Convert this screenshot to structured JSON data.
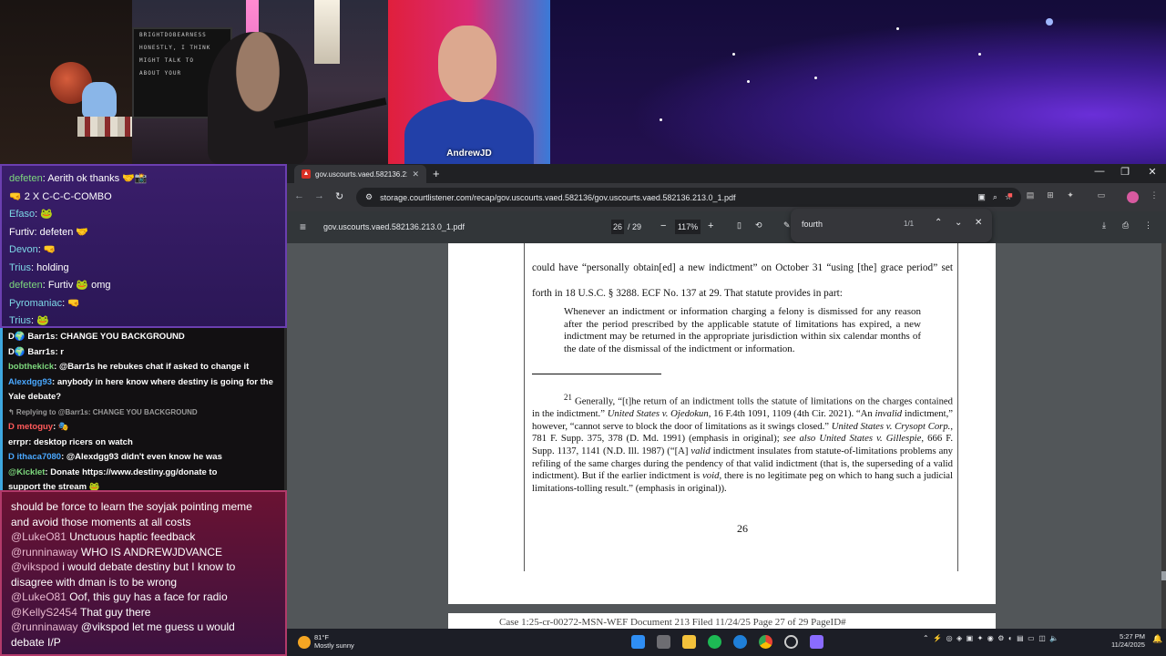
{
  "stream": {
    "cam1_lightbox_text": [
      "BRIGHTDOBEARNESS",
      "HONESTLY, I THINK",
      "MIGHT TALK TO",
      "ABOUT YOUR"
    ],
    "cam2_name": "AndrewJD"
  },
  "chat_a": [
    {
      "name": "defeten",
      "name_color": "#7dd87d",
      "text": "Aerith ok thanks 🤝📸"
    },
    {
      "name": "",
      "name_color": "#ffffff",
      "text": "🤜 2 X C-C-C-COMBO"
    },
    {
      "name": "Efaso",
      "name_color": "#7dd8e6",
      "text": "🐸"
    },
    {
      "name": "Furtiv",
      "name_color": "#ffffff",
      "text": "defeten 🤝"
    },
    {
      "name": "Devon",
      "name_color": "#7dd8e6",
      "text": "🤜"
    },
    {
      "name": "Trius",
      "name_color": "#7dd8e6",
      "text": "holding"
    },
    {
      "name": "defeten",
      "name_color": "#7dd87d",
      "text": "Furtiv 🐸 omg"
    },
    {
      "name": "Pyromaniac",
      "name_color": "#7dd8e6",
      "text": "🤜"
    },
    {
      "name": "Trius",
      "name_color": "#7dd8e6",
      "text": "🐸"
    }
  ],
  "chat_b": [
    {
      "name": "D🌍 Barr1s",
      "name_color": "#ffffff",
      "text": "CHANGE YOU BACKGROUND"
    },
    {
      "name": "D🌍 Barr1s",
      "name_color": "#ffffff",
      "text": "r"
    },
    {
      "name": "bobthekick",
      "name_color": "#7dd87d",
      "text": "@Barr1s he rebukes chat if asked to change it"
    },
    {
      "name": "Alexdgg93",
      "name_color": "#4aa8ff",
      "text": "anybody in here know where destiny is going for the"
    },
    {
      "name": "",
      "name_color": "#ffffff",
      "text": "Yale debate?"
    },
    {
      "name": "reply",
      "name_color": "#9a9a9a",
      "text": "↰ Replying to @Barr1s: CHANGE YOU BACKGROUND"
    },
    {
      "name": "D metoguy",
      "name_color": "#ff5a5a",
      "text": "🎭"
    },
    {
      "name": "errpr",
      "name_color": "#ffffff",
      "text": "desktop ricers on watch"
    },
    {
      "name": "D ithaca7080",
      "name_color": "#4aa8ff",
      "text": "@Alexdgg93 didn't even know he was"
    },
    {
      "name": "@Kicklet",
      "name_color": "#7dd87d",
      "text": "Donate https://www.destiny.gg/donate to"
    },
    {
      "name": "",
      "name_color": "#ffffff",
      "text": "support the stream 🐸"
    }
  ],
  "chat_c": [
    {
      "at": "",
      "text": "should be force to learn the soyjak pointing meme"
    },
    {
      "at": "",
      "text": "and avoid those moments at all costs"
    },
    {
      "at": "@LukeO81",
      "text": " Unctuous haptic feedback"
    },
    {
      "at": "@runninaway",
      "text": " WHO IS ANDREWJDVANCE"
    },
    {
      "at": "@vikspod",
      "text": " i would debate destiny but I know to"
    },
    {
      "at": "",
      "text": "disagree with dman is to be wrong"
    },
    {
      "at": "@LukeO81",
      "text": " Oof, this guy has a face for radio"
    },
    {
      "at": "@KellyS2454",
      "text": " That guy there"
    },
    {
      "at": "@runninaway",
      "text": " @vikspod let me guess u would"
    },
    {
      "at": "",
      "text": "debate I/P"
    }
  ],
  "browser": {
    "tab_title": "gov.uscourts.vaed.582136.213.0_1.pdf",
    "url": "storage.courtlistener.com/recap/gov.uscourts.vaed.582136/gov.uscourts.vaed.582136.213.0_1.pdf",
    "pdf_title": "gov.uscourts.vaed.582136.213.0_1.pdf",
    "page_current": "26",
    "page_total": "/ 29",
    "zoom": "117%",
    "find_query": "fourth",
    "find_count": "1/1"
  },
  "document": {
    "p1": "could have “personally obtain[ed] a new indictment” on October 31 “using [the] grace period” set forth in 18 U.S.C. § 3288.  ECF No. 137 at 29.  That statute provides in part:",
    "quote": "Whenever an indictment or information charging a felony is dismissed for any reason after the period prescribed by the applicable statute of limitations has expired, a new indictment may be returned in the appropriate jurisdiction within six calendar months of the date of the dismissal of the indictment or information.",
    "fn_num": "21",
    "fn_a": " Generally, “[t]he return of an indictment tolls the statute of limitations on the charges contained in the indictment.”  ",
    "fn_b": "United States v. Ojedokun",
    "fn_c": ", 16 F.4th 1091, 1109 (4th Cir. 2021).  “An ",
    "fn_d": "invalid",
    "fn_e": " indictment,” however, “cannot serve to block the door of limitations as it swings closed.” ",
    "fn_f": "United States v. Crysopt Corp.",
    "fn_g": ", 781 F. Supp. 375, 378 (D. Md. 1991) (emphasis in original); ",
    "fn_h": "see also United States v. Gillespie",
    "fn_i": ", 666 F. Supp. 1137, 1141 (N.D. Ill. 1987) (“[A] ",
    "fn_j": "valid",
    "fn_k": " indictment insulates from statute-of-limitations problems any refiling of the same charges during the pendency of that valid indictment (that is, the superseding of a valid indictment).  But if the earlier indictment is ",
    "fn_l": "void,",
    "fn_m": " there is no legitimate peg on which to hang such a judicial limitations-tolling result.” (emphasis in original)).",
    "page_number": "26",
    "next_header": "Case 1:25-cr-00272-MSN-WEF     Document 213     Filed 11/24/25     Page 27 of 29 PageID#"
  },
  "taskbar": {
    "temp": "81°F",
    "weather": "Mostly sunny",
    "time": "5:27 PM",
    "date": "11/24/2025"
  }
}
